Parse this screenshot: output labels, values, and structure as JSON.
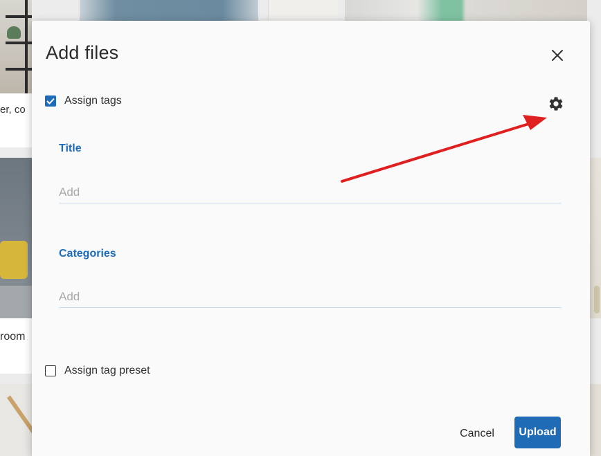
{
  "background": {
    "caption_partial_1": "er, co",
    "caption_partial_2": "room"
  },
  "dialog": {
    "title": "Add files",
    "close_icon": "close-icon",
    "assign_tags": {
      "label": "Assign tags",
      "checked": true
    },
    "settings_icon": "gear-icon",
    "fields": {
      "title": {
        "label": "Title",
        "value": "",
        "placeholder": "Add"
      },
      "categories": {
        "label": "Categories",
        "value": "",
        "placeholder": "Add"
      }
    },
    "assign_tag_preset": {
      "label": "Assign tag preset",
      "checked": false
    },
    "buttons": {
      "cancel": "Cancel",
      "upload": "Upload"
    }
  },
  "annotation": {
    "type": "arrow",
    "color": "#e02020",
    "points_to": "gear-icon"
  },
  "colors": {
    "accent": "#1e6bb8",
    "dialog_background": "#fafafa",
    "placeholder": "#a9a9a9"
  }
}
